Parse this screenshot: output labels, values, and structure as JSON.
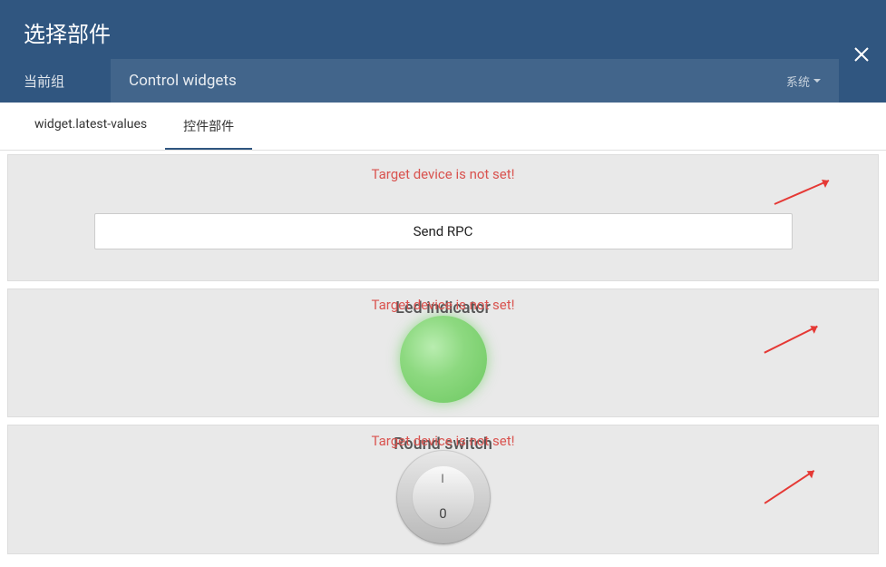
{
  "header": {
    "title": "选择部件",
    "groupLabel": "当前组",
    "groupName": "Control widgets",
    "systemLabel": "系统"
  },
  "tabs": [
    {
      "label": "widget.latest-values",
      "active": false
    },
    {
      "label": "控件部件",
      "active": true
    }
  ],
  "widgets": [
    {
      "error": "Target device is not set!",
      "buttonLabel": "Send RPC"
    },
    {
      "error": "Target device is not set!",
      "title": "Led indicator"
    },
    {
      "error": "Target device is not set!",
      "title": "Round switch",
      "markI": "I",
      "markO": "0"
    }
  ]
}
